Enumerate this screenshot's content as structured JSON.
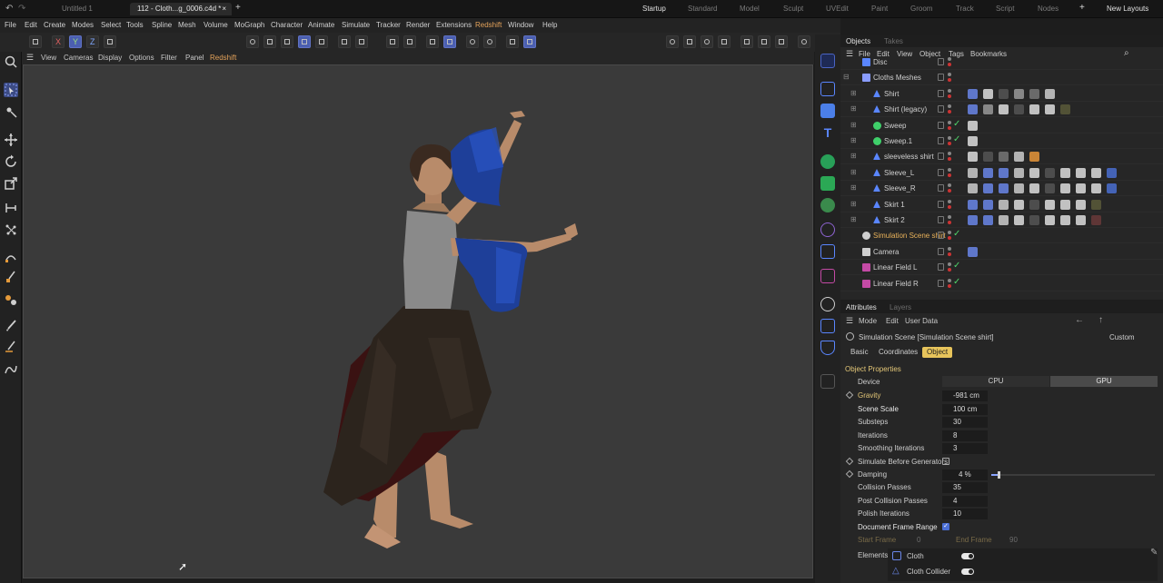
{
  "tabs": [
    {
      "label": "Untitled 1",
      "active": false
    },
    {
      "label": "112 - Cloth...g_0006.c4d *",
      "active": true
    }
  ],
  "tab_close": "×",
  "new_tab": "+",
  "layouts": [
    "Startup",
    "Standard",
    "Model",
    "Sculpt",
    "UVEdit",
    "Paint",
    "Groom",
    "Track",
    "Script",
    "Nodes"
  ],
  "active_layout": "Startup",
  "layout_add": "+",
  "new_layouts": "New Layouts",
  "menu": [
    "File",
    "Edit",
    "Create",
    "Modes",
    "Select",
    "Tools",
    "Spline",
    "Mesh",
    "Volume",
    "MoGraph",
    "Character",
    "Animate",
    "Simulate",
    "Tracker",
    "Render",
    "Extensions",
    "Redshift",
    "Window",
    "Help"
  ],
  "toolbar_axes": {
    "x": "X",
    "y": "Y",
    "z": "Z"
  },
  "viewport_menu": [
    "View",
    "Cameras",
    "Display",
    "Options",
    "Filter",
    "Panel",
    "Redshift"
  ],
  "objects": {
    "tabs": [
      "Objects",
      "Takes"
    ],
    "menu": [
      "File",
      "Edit",
      "View",
      "Object",
      "Tags",
      "Bookmarks"
    ],
    "rows": [
      {
        "name": "Disc",
        "indent": 1,
        "kind": "disc"
      },
      {
        "name": "Cloths Meshes",
        "indent": 1,
        "kind": "null"
      },
      {
        "name": "Shirt",
        "indent": 2,
        "kind": "mesh"
      },
      {
        "name": "Shirt (legacy)",
        "indent": 2,
        "kind": "mesh"
      },
      {
        "name": "Sweep",
        "indent": 2,
        "kind": "sweep"
      },
      {
        "name": "Sweep.1",
        "indent": 2,
        "kind": "sweep"
      },
      {
        "name": "sleeveless shirt",
        "indent": 2,
        "kind": "mesh"
      },
      {
        "name": "Sleeve_L",
        "indent": 2,
        "kind": "mesh"
      },
      {
        "name": "Sleeve_R",
        "indent": 2,
        "kind": "mesh"
      },
      {
        "name": "Skirt 1",
        "indent": 2,
        "kind": "mesh"
      },
      {
        "name": "Skirt 2",
        "indent": 2,
        "kind": "mesh"
      },
      {
        "name": "Simulation Scene shirt",
        "indent": 1,
        "kind": "sim",
        "highlight": true
      },
      {
        "name": "Camera",
        "indent": 1,
        "kind": "camera"
      },
      {
        "name": "Linear Field L",
        "indent": 1,
        "kind": "field"
      },
      {
        "name": "Linear Field R",
        "indent": 1,
        "kind": "field"
      }
    ]
  },
  "attributes": {
    "tabs": [
      "Attributes",
      "Layers"
    ],
    "menu": [
      "Mode",
      "Edit",
      "User Data"
    ],
    "title": "Simulation Scene [Simulation Scene shirt]",
    "preset": "Custom",
    "subtabs": [
      "Basic",
      "Coordinates",
      "Object"
    ],
    "active_subtab": "Object",
    "section": "Object Properties",
    "device_label": "Device",
    "device_options": [
      "CPU",
      "GPU"
    ],
    "device_selected": "GPU",
    "props": [
      {
        "label": "Gravity",
        "value": "-981 cm",
        "diamond": true,
        "yellow": true
      },
      {
        "label": "Scene Scale",
        "value": "100 cm",
        "diamond": false,
        "white": true
      },
      {
        "label": "Substeps",
        "value": "30",
        "diamond": false
      },
      {
        "label": "Iterations",
        "value": "8",
        "diamond": false
      },
      {
        "label": "Smoothing Iterations",
        "value": "3",
        "diamond": false
      }
    ],
    "simulate_before_generators": "Simulate Before Generators",
    "damping": {
      "label": "Damping",
      "value": "4 %",
      "fraction": 0.04
    },
    "props2": [
      {
        "label": "Collision Passes",
        "value": "35"
      },
      {
        "label": "Post Collision Passes",
        "value": "4"
      },
      {
        "label": "Polish Iterations",
        "value": "10"
      }
    ],
    "document_frame_range": "Document Frame Range",
    "start_frame": {
      "label": "Start Frame",
      "value": "0"
    },
    "end_frame": {
      "label": "End Frame",
      "value": "90"
    },
    "elements_label": "Elements",
    "elements": [
      "Cloth",
      "Cloth Collider"
    ]
  }
}
